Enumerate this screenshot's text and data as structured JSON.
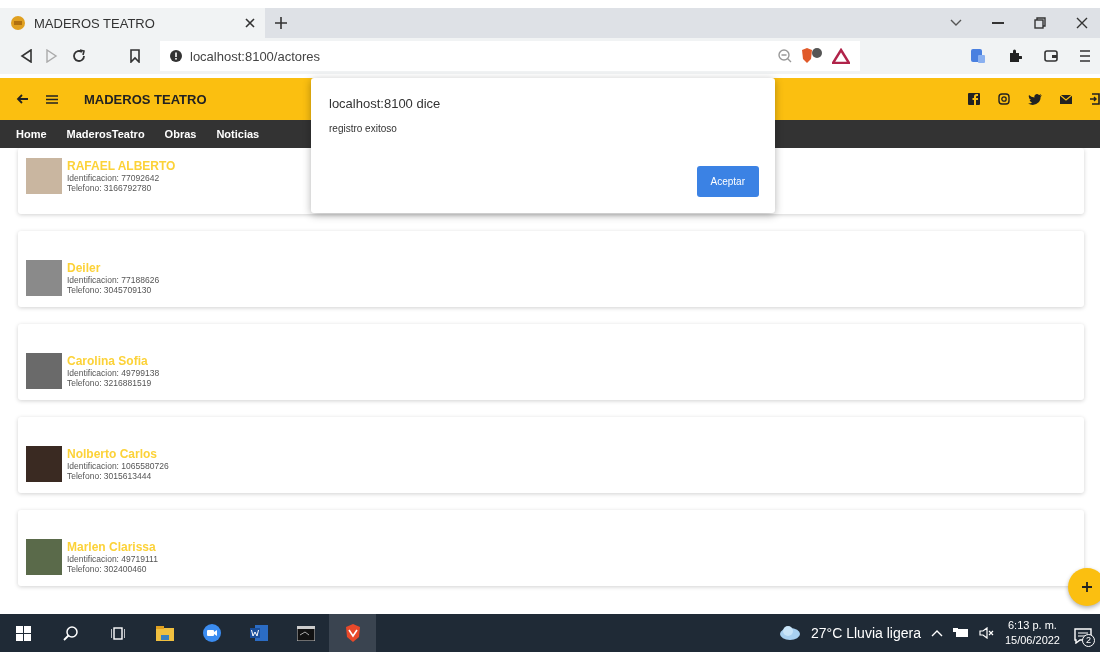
{
  "browser": {
    "tabs": [
      {
        "title": "MADEROS TEATRO",
        "selected": true
      }
    ],
    "address": "localhost:8100/actores"
  },
  "app": {
    "title": "MADEROS TEATRO",
    "nav": [
      {
        "label": "Home"
      },
      {
        "label": "MaderosTeatro"
      },
      {
        "label": "Obras"
      },
      {
        "label": "Noticias"
      }
    ],
    "actors": [
      {
        "name": "RAFAEL ALBERTO",
        "identification": "Identificacion: 77092642",
        "phone": "Telefono: 3166792780"
      },
      {
        "name": "Deiler",
        "identification": "Identificacion: 77188626",
        "phone": "Telefono: 3045709130"
      },
      {
        "name": "Carolina Sofia",
        "identification": "Identificacion: 49799138",
        "phone": "Telefono: 3216881519"
      },
      {
        "name": "Nolberto Carlos",
        "identification": "Identificacion: 1065580726",
        "phone": "Telefono: 3015613444"
      },
      {
        "name": "Marlen Clarissa",
        "identification": "Identificacion: 49719111",
        "phone": "Telefono: 302400460"
      }
    ]
  },
  "dialog": {
    "title": "localhost:8100 dice",
    "message": "registro exitoso",
    "button": "Aceptar"
  },
  "taskbar": {
    "weather": "27°C  Lluvia ligera",
    "time": "6:13 p. m.",
    "date": "15/06/2022",
    "notifications": "2"
  }
}
